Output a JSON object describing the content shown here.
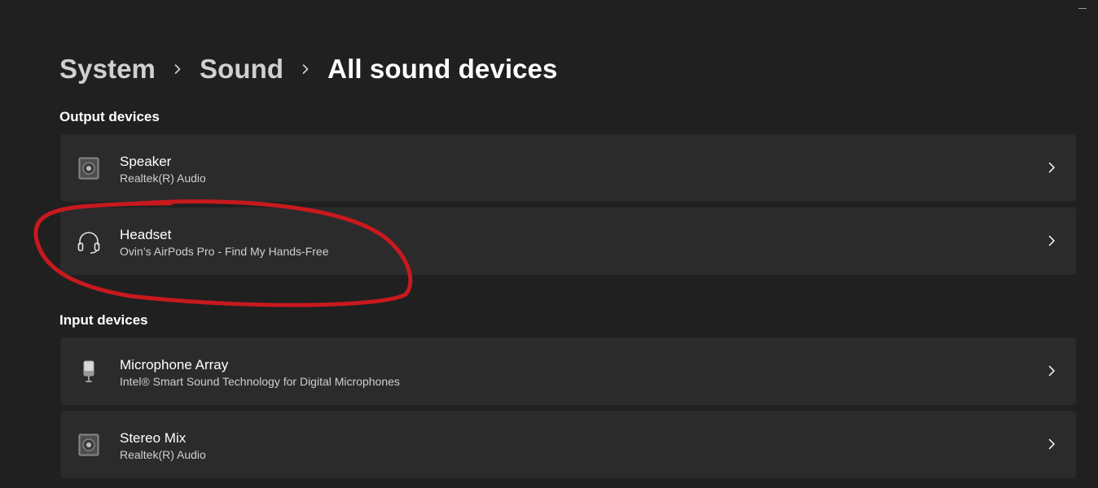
{
  "breadcrumb": {
    "items": [
      "System",
      "Sound"
    ],
    "current": "All sound devices"
  },
  "output_section": {
    "title": "Output devices",
    "devices": [
      {
        "name": "Speaker",
        "description": "Realtek(R) Audio",
        "icon": "speaker-icon"
      },
      {
        "name": "Headset",
        "description": "Ovin’s AirPods Pro - Find My Hands-Free",
        "icon": "headset-icon"
      }
    ]
  },
  "input_section": {
    "title": "Input devices",
    "devices": [
      {
        "name": "Microphone Array",
        "description": "Intel® Smart Sound Technology for Digital Microphones",
        "icon": "microphone-icon"
      },
      {
        "name": "Stereo Mix",
        "description": "Realtek(R) Audio",
        "icon": "speaker-icon"
      }
    ]
  },
  "colors": {
    "background": "#202020",
    "card": "#2b2b2b",
    "annotation": "#c8191e"
  }
}
